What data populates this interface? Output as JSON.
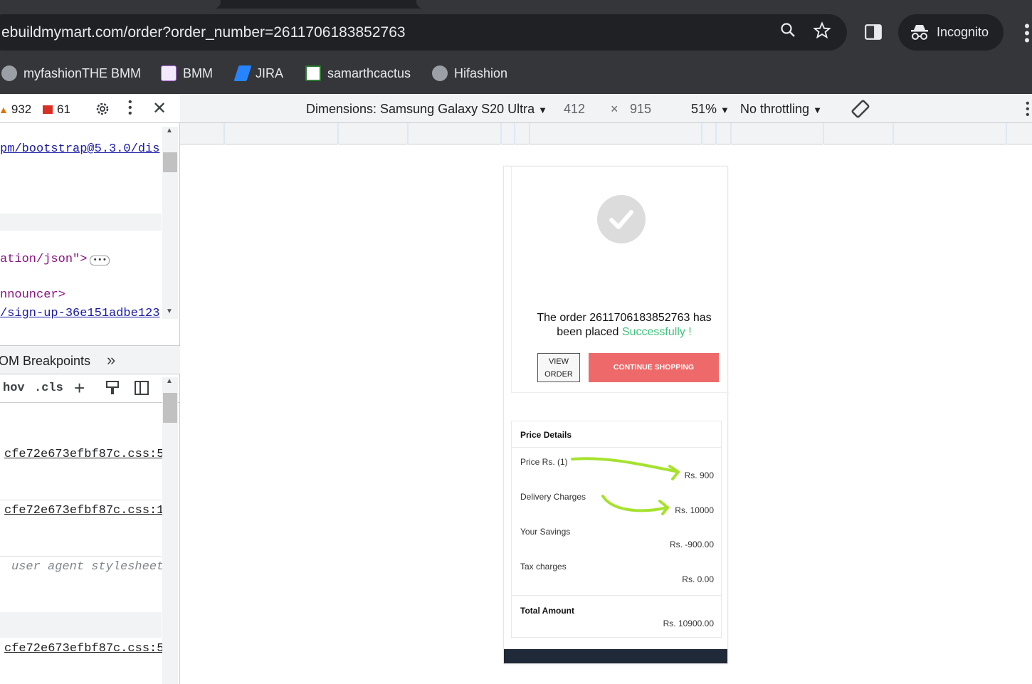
{
  "browser": {
    "url": "ebuildmymart.com/order?order_number=2611706183852763",
    "incognito_label": "Incognito",
    "bookmarks": [
      {
        "label": "myfashionTHE BMM",
        "icon": "globe-icon"
      },
      {
        "label": "BMM",
        "icon": "bmm-favicon"
      },
      {
        "label": "JIRA",
        "icon": "jira-icon"
      },
      {
        "label": "samarthcactus",
        "icon": "cactus-favicon"
      },
      {
        "label": "Hifashion",
        "icon": "globe-icon"
      }
    ]
  },
  "devtools": {
    "warnings": "932",
    "errors": "61",
    "code_lines": [
      "pm/bootstrap@5.3.0/dis",
      "ation/json\">",
      "nnouncer>",
      "/sign-up-36e151adbe123"
    ],
    "dom_breakpoints": "OM Breakpoints",
    "styles_toolbar": {
      "hov": "hov",
      "cls": ".cls"
    },
    "style_sources": [
      "cfe72e673efbf87c.css:5",
      "cfe72e673efbf87c.css:1",
      "user agent stylesheet",
      "cfe72e673efbf87c.css:5"
    ]
  },
  "emulation": {
    "dimensions": "Dimensions: Samsung Galaxy S20 Ultra",
    "width": "412",
    "times": "×",
    "height": "915",
    "zoom": "51%",
    "throttling": "No throttling"
  },
  "page": {
    "order_text_1": "The order 2611706183852763 has",
    "order_text_2": "been placed ",
    "success_word": "Successfully !",
    "view_order_line1": "VIEW",
    "view_order_line2": "ORDER",
    "continue_shopping": "CONTINUE SHOPPING",
    "price_details": {
      "title": "Price Details",
      "rows": [
        {
          "label": "Price Rs. (1)",
          "value": "Rs. 900"
        },
        {
          "label": "Delivery Charges",
          "value": "Rs. 10000"
        },
        {
          "label": "Your Savings",
          "value": "Rs. -900.00"
        },
        {
          "label": "Tax charges",
          "value": "Rs. 0.00"
        }
      ],
      "total_label": "Total Amount",
      "total_value": "Rs. 10900.00"
    },
    "annotation_color": "#a6e22e",
    "success_color": "#3fc37c",
    "button_color": "#ee6a6a"
  }
}
